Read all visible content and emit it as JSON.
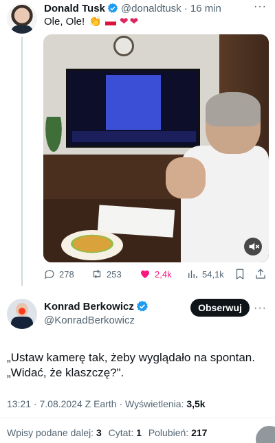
{
  "quoted": {
    "name": "Donald Tusk",
    "handle": "@donaldtusk",
    "time": "· 16 min",
    "text": "Ole, Ole!",
    "emojis": [
      "clap-hands",
      "poland-flag",
      "red-heart",
      "red-heart"
    ],
    "more": "···",
    "media": {
      "type": "video",
      "description_icon": "mute-icon"
    },
    "actions": {
      "replies": "278",
      "reposts": "253",
      "likes": "2,4k",
      "views": "54,1k"
    }
  },
  "tweet": {
    "name": "Konrad Berkowicz",
    "handle": "@KonradBerkowicz",
    "follow_label": "Obserwuj",
    "more": "···",
    "text_line1": "„Ustaw kamerę tak, żeby wyglądało na spontan.",
    "text_line2": "„Widać, że klaszczę?\".",
    "meta_prefix": "13:21 · 7.08.2024 Z Earth · Wyświetlenia: ",
    "views": "3,5k",
    "stats": {
      "reposts_label": "Wpisy podane dalej: ",
      "reposts": "3",
      "quotes_label": "Cytat: ",
      "quotes": "1",
      "likes_label": "Polubień: ",
      "likes": "217"
    }
  },
  "colors": {
    "verified": "#1d9bf0",
    "like_active": "#f91880",
    "secondary_text": "#536471",
    "follow_bg": "#0f1419"
  }
}
